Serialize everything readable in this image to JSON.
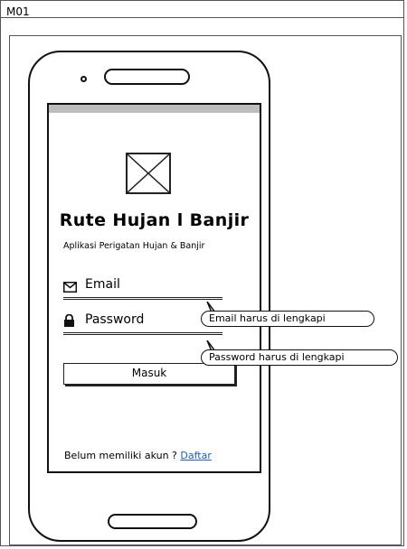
{
  "frame": {
    "title": "M01"
  },
  "app": {
    "title": "Rute Hujan l Banjir",
    "subtitle": "Aplikasi Perigatan Hujan & Banjir"
  },
  "form": {
    "email_label": "Email",
    "password_label": "Password",
    "submit_label": "Masuk"
  },
  "callouts": {
    "email_required": "Email harus di lengkapi",
    "password_required": "Password harus di lengkapi"
  },
  "footer": {
    "prompt": "Belum memiliki akun ?",
    "register_link": "Daftar"
  },
  "icons": {
    "email": "envelope-icon",
    "password": "lock-icon",
    "image": "image-placeholder-icon"
  }
}
